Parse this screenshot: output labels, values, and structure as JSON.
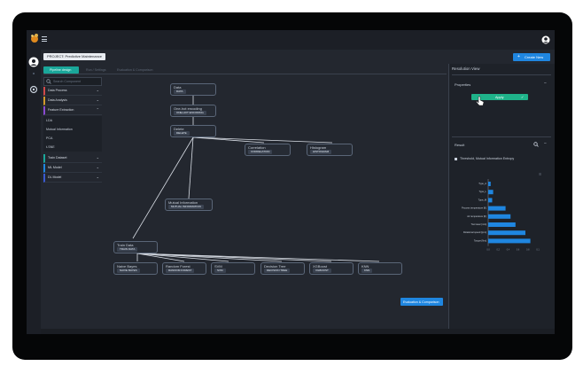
{
  "header": {
    "project_label": "PROJECT: Predictive Maintenance",
    "create_new_label": "Create New",
    "create_new_plus": "+"
  },
  "tabs": [
    {
      "label": "Pipeline design"
    },
    {
      "label": "Run / Settings"
    },
    {
      "label": "Evaluation & Comparison"
    }
  ],
  "search": {
    "placeholder": "Search Component"
  },
  "sidebar": {
    "groups": [
      {
        "label": "Data Process",
        "chev": "⌄"
      },
      {
        "label": "Data Analysis",
        "chev": "⌄"
      },
      {
        "label": "Feature Extraction",
        "chev": "⌃"
      }
    ],
    "sub_items": [
      "LDA",
      "Mutual Information",
      "PCA",
      "t-SNE"
    ],
    "groups2": [
      {
        "label": "Train Dataset",
        "chev": "⌄"
      },
      {
        "label": "ML Model",
        "chev": "⌄"
      },
      {
        "label": "DL Model",
        "chev": "⌄"
      }
    ]
  },
  "nodes": {
    "data": {
      "title": "Data",
      "badge": "DATA"
    },
    "onehot": {
      "title": "One-hot encoding",
      "badge": "ONE-HOT ENCODING"
    },
    "delete": {
      "title": "Delete",
      "badge": "DELETE"
    },
    "correlation": {
      "title": "Correlation",
      "badge": "CORRELATION"
    },
    "histogram": {
      "title": "Histogram",
      "badge": "HISTOGRAM"
    },
    "mutual": {
      "title": "Mutual Information",
      "badge": "MUTUAL INFORMATION"
    },
    "train": {
      "title": "Train Data",
      "badge": "TRAIN DATA"
    },
    "naive": {
      "title": "Naive Bayes",
      "badge": "NAIVE BAYES"
    },
    "rf": {
      "title": "Random Forest",
      "badge": "RANDOM FOREST"
    },
    "svm": {
      "title": "SVM",
      "badge": "SVM"
    },
    "dt": {
      "title": "Decision Tree",
      "badge": "DECISION TREE"
    },
    "xgb": {
      "title": "XGBoost",
      "badge": "XGBOOST"
    },
    "knn": {
      "title": "KNN",
      "badge": "KNN"
    }
  },
  "eval_button": {
    "label": "Evaluation & Comparison"
  },
  "right_panel": {
    "title": "Resolution View",
    "properties_title": "Properties",
    "apply_label": "Apply",
    "apply_check": "✓",
    "result_title": "Result",
    "result_desc": "Threshold, Mutual Information Entropy",
    "collapse": "−"
  },
  "chart_data": {
    "type": "bar",
    "orientation": "horizontal",
    "categories": [
      "Type_A",
      "Type_L",
      "Type_M",
      "Process temperature [K]",
      "Air temperature [K]",
      "Tool wear [min]",
      "Rotational speed [rpm]",
      "Torque [Nm]"
    ],
    "values": [
      0.005,
      0.01,
      0.008,
      0.035,
      0.045,
      0.055,
      0.075,
      0.085
    ],
    "xlim": [
      0,
      0.1
    ],
    "xticks": [
      "0.0",
      "0.2",
      "0.4",
      "0.6",
      "0.8",
      "0.1"
    ],
    "color": "#1f86e0"
  },
  "colors": {
    "accent": "#1f86e0",
    "apply": "#1fb38a",
    "tab_active": "#1aa79a"
  }
}
